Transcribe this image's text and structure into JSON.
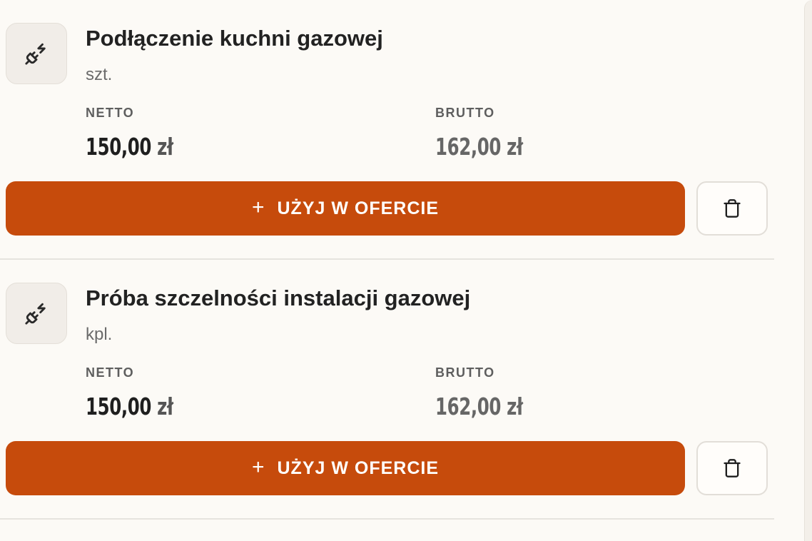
{
  "items": [
    {
      "icon": "plug-icon",
      "title": "Podłączenie kuchni gazowej",
      "unit": "szt.",
      "netto_label": "NETTO",
      "netto_value": "150,00",
      "netto_currency": "zł",
      "brutto_label": "BRUTTO",
      "brutto_value": "162,00",
      "brutto_currency": "zł",
      "use_plus": "+",
      "use_label": "UŻYJ W OFERCIE",
      "delete_icon": "trash-icon"
    },
    {
      "icon": "plug-icon",
      "title": "Próba szczelności instalacji gazowej",
      "unit": "kpl.",
      "netto_label": "NETTO",
      "netto_value": "150,00",
      "netto_currency": "zł",
      "brutto_label": "BRUTTO",
      "brutto_value": "162,00",
      "brutto_currency": "zł",
      "use_plus": "+",
      "use_label": "UŻYJ W OFERCIE",
      "delete_icon": "trash-icon"
    }
  ],
  "colors": {
    "accent": "#c64b0c",
    "background": "#fcfaf6",
    "text": "#222222",
    "muted": "#6b6b6b",
    "divider": "#e6e3de"
  }
}
